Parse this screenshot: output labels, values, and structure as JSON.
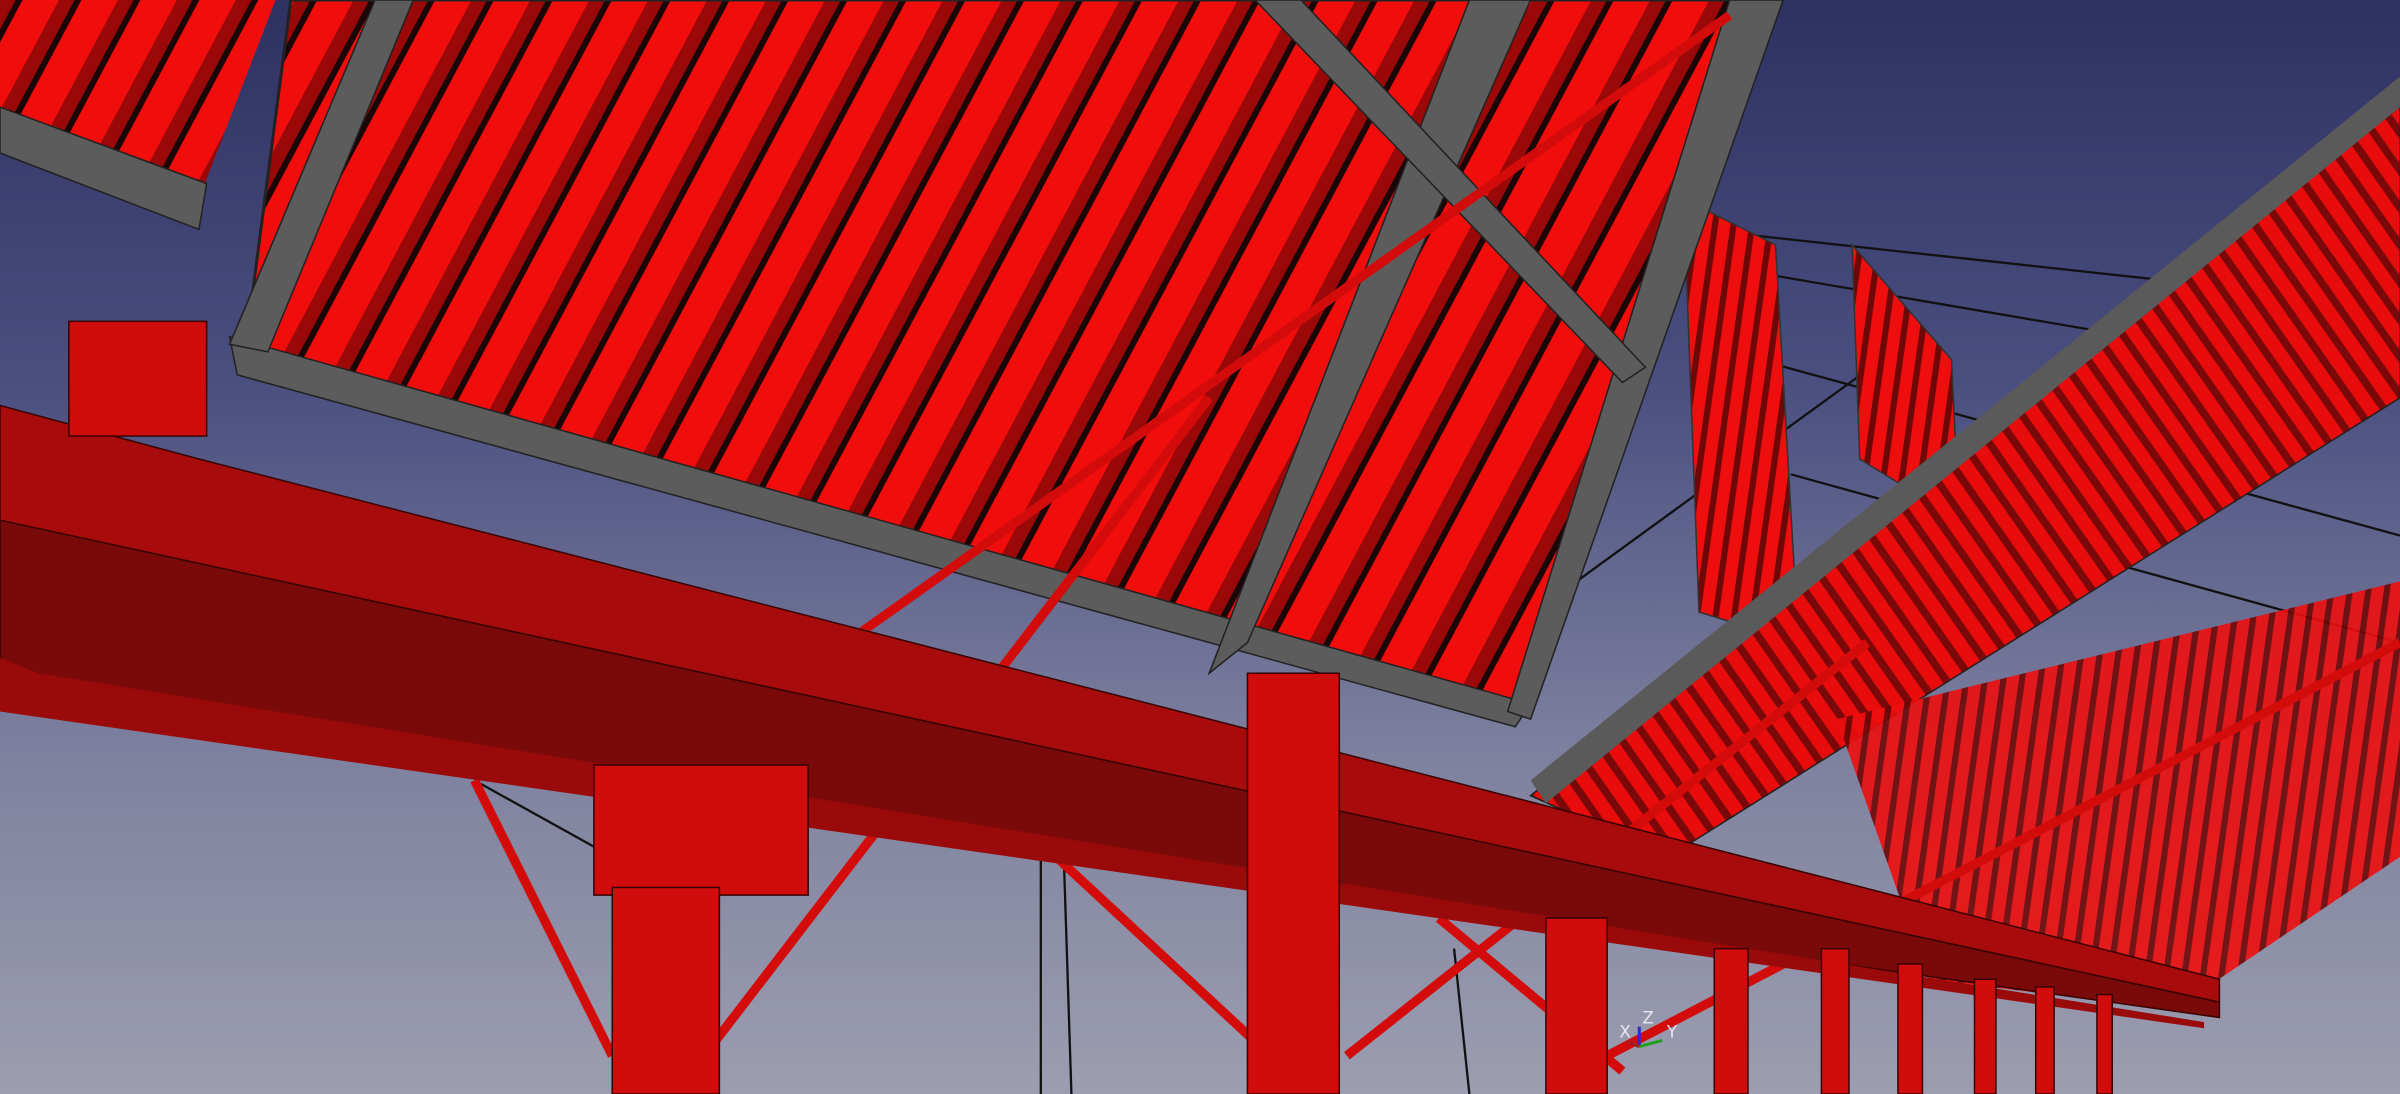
{
  "viewport": {
    "kind": "3d-view",
    "colors": {
      "steel": "#e00c0c",
      "steel_dark": "#8c0a0a",
      "frame": "#5a5a5a",
      "sky_top": "#2e3162",
      "sky_bottom": "#9c9db0"
    }
  },
  "axis_indicator": {
    "x_label": "X",
    "y_label": "Y",
    "z_label": "Z"
  }
}
